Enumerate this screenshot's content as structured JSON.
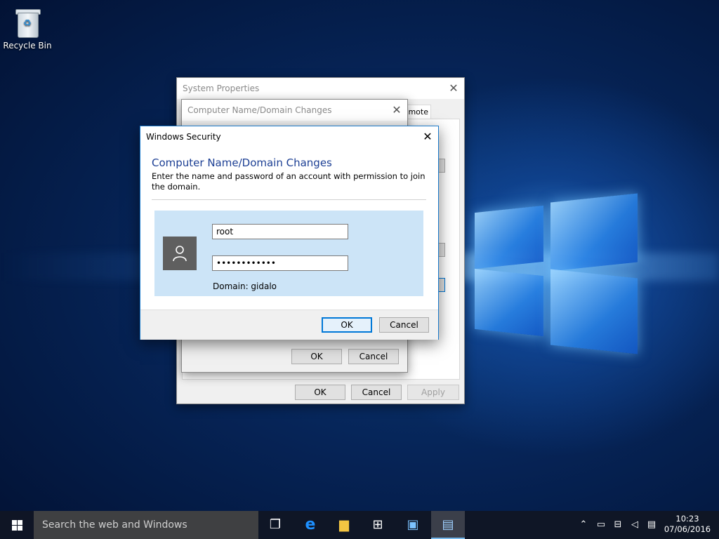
{
  "desktop": {
    "recycle_bin_label": "Recycle Bin"
  },
  "system_properties": {
    "title": "System Properties",
    "tab_remote": "emote",
    "ok_label": "OK",
    "cancel_label": "Cancel",
    "apply_label": "Apply"
  },
  "name_changes": {
    "title": "Computer Name/Domain Changes",
    "ok_label": "OK",
    "cancel_label": "Cancel"
  },
  "security": {
    "title": "Windows Security",
    "heading": "Computer Name/Domain Changes",
    "description": "Enter the name and password of an account with permission to join the domain.",
    "username_value": "root",
    "password_value": "••••••••••••",
    "domain_text": "Domain: gidalo",
    "ok_label": "OK",
    "cancel_label": "Cancel",
    "accent_color": "#1c3f94"
  },
  "taskbar": {
    "search_placeholder": "Search the web and Windows",
    "time": "10:23",
    "date": "07/06/2016"
  }
}
